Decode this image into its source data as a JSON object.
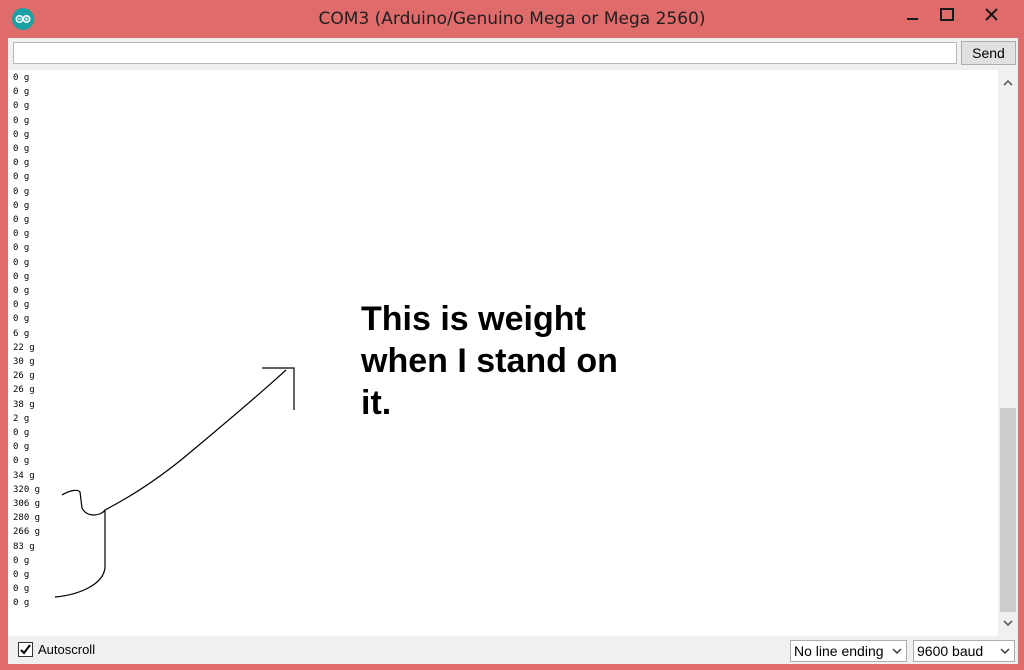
{
  "window": {
    "title": "COM3 (Arduino/Genuino Mega or Mega 2560)",
    "accent_color": "#e06b6b",
    "icon": "arduino-logo-icon"
  },
  "controls": {
    "minimize_icon": "minimize-icon",
    "maximize_icon": "maximize-icon",
    "close_icon": "close-icon"
  },
  "input": {
    "value": "",
    "send_label": "Send"
  },
  "output": {
    "lines": [
      "0 g",
      "0 g",
      "0 g",
      "0 g",
      "0 g",
      "0 g",
      "0 g",
      "0 g",
      "0 g",
      "0 g",
      "0 g",
      "0 g",
      "0 g",
      "0 g",
      "0 g",
      "0 g",
      "0 g",
      "0 g",
      "6 g",
      "22 g",
      "30 g",
      "26 g",
      "26 g",
      "38 g",
      "2 g",
      "0 g",
      "0 g",
      "0 g",
      "34 g",
      "320 g",
      "306 g",
      "280 g",
      "266 g",
      "83 g",
      "0 g",
      "0 g",
      "0 g",
      "0 g"
    ]
  },
  "annotation": {
    "lines": [
      "This is weight",
      "when I stand on",
      "it."
    ]
  },
  "footer": {
    "autoscroll_label": "Autoscroll",
    "autoscroll_checked": true,
    "line_ending": "No line ending",
    "baud": "9600 baud"
  }
}
